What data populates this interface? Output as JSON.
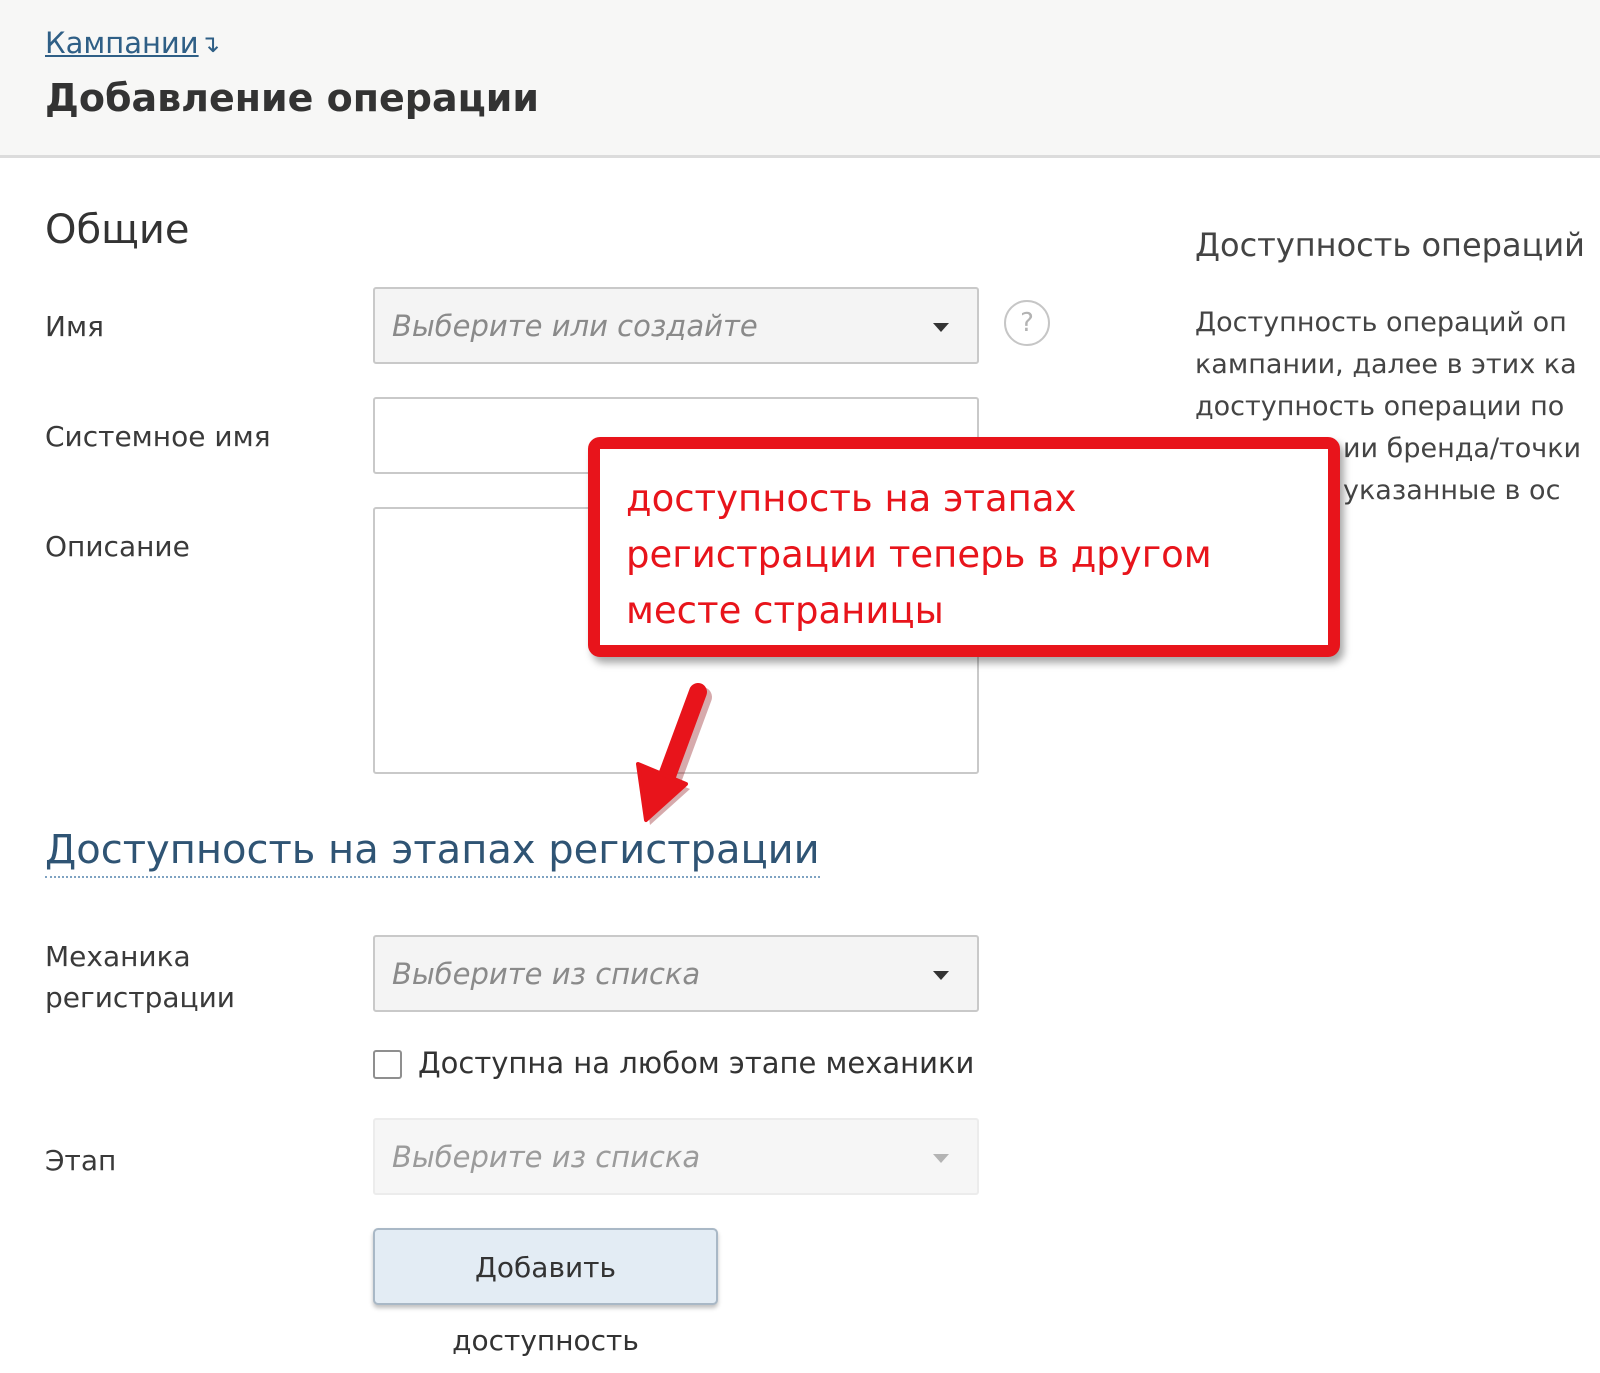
{
  "header": {
    "breadcrumb": "Кампании",
    "breadcrumb_arrow": "↴",
    "title": "Добавление операции"
  },
  "general": {
    "section_title": "Общие",
    "name_label": "Имя",
    "name_placeholder": "Выберите или создайте",
    "help_icon_glyph": "?",
    "system_name_label": "Системное имя",
    "description_label": "Описание"
  },
  "right_panel": {
    "heading": "Доступность операций",
    "lines": [
      "Доступность операций оп",
      "кампании, далее в этих ка",
      "доступность операции по",
      "ии бренда/точки",
      "указанные в ос"
    ]
  },
  "registration": {
    "section_title": "Доступность на этапах регистрации",
    "mechanics_label_line1": "Механика",
    "mechanics_label_line2": "регистрации",
    "mechanics_placeholder": "Выберите из списка",
    "any_stage_checkbox": "Доступна на любом этапе механики",
    "any_stage_checked": false,
    "stage_label": "Этап",
    "stage_placeholder": "Выберите из списка",
    "add_button": "Добавить доступность"
  },
  "annotation": {
    "line1": "доступность на этапах",
    "line2": "регистрации теперь в другом",
    "line3": "месте страницы",
    "color": "#e8141b"
  }
}
